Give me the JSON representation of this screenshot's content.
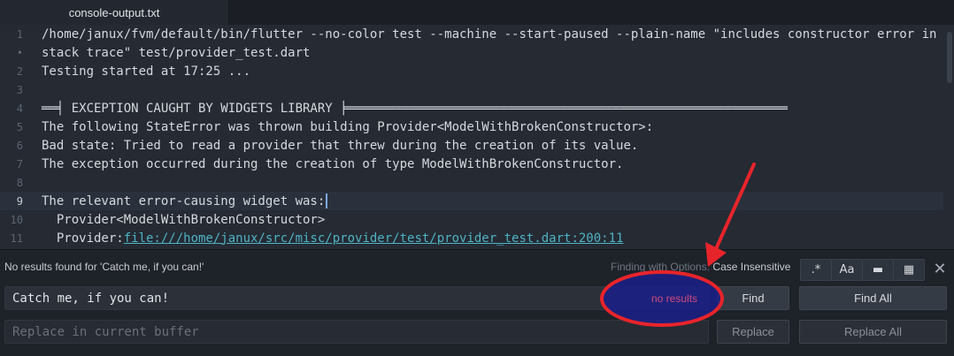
{
  "tab": {
    "title": "console-output.txt"
  },
  "editor": {
    "lines": [
      {
        "num": "1",
        "text": "/home/janux/fvm/default/bin/flutter --no-color test --machine --start-paused --plain-name \"includes constructor error in"
      },
      {
        "num": "•",
        "text": "stack trace\" test/provider_test.dart"
      },
      {
        "num": "2",
        "text": "Testing started at 17:25 ..."
      },
      {
        "num": "3",
        "text": ""
      },
      {
        "num": "4",
        "text": "══╡ EXCEPTION CAUGHT BY WIDGETS LIBRARY ╞═══════════════════════════════════════════════════════════"
      },
      {
        "num": "5",
        "text": "The following StateError was thrown building Provider<ModelWithBrokenConstructor>:"
      },
      {
        "num": "6",
        "text": "Bad state: Tried to read a provider that threw during the creation of its value."
      },
      {
        "num": "7",
        "text": "The exception occurred during the creation of type ModelWithBrokenConstructor."
      },
      {
        "num": "8",
        "text": ""
      },
      {
        "num": "9",
        "text": "The relevant error-causing widget was:"
      },
      {
        "num": "10",
        "text": "  Provider<ModelWithBrokenConstructor>"
      },
      {
        "num": "11",
        "prefix": "  Provider:",
        "link": "file:///home/janux/src/misc/provider/test/provider_test.dart:200:11"
      }
    ]
  },
  "find": {
    "status": "No results found for 'Catch me, if you can!'",
    "options_prefix": "Finding with Options:",
    "options_value": "Case Insensitive",
    "toggles": {
      "regex": ".*",
      "case": "Aa",
      "selection": "▬",
      "word": "▦"
    },
    "close": "✕",
    "query": "Catch me, if you can!",
    "result_badge": "no results",
    "replace_placeholder": "Replace in current buffer",
    "find_label": "Find",
    "find_all_label": "Find All",
    "replace_label": "Replace",
    "replace_all_label": "Replace All"
  },
  "colors": {
    "annotation": "#e8242b",
    "highlight_fill": "#1a1f8c",
    "no_results_text": "#d04a7c",
    "link": "#4fb3c4"
  }
}
